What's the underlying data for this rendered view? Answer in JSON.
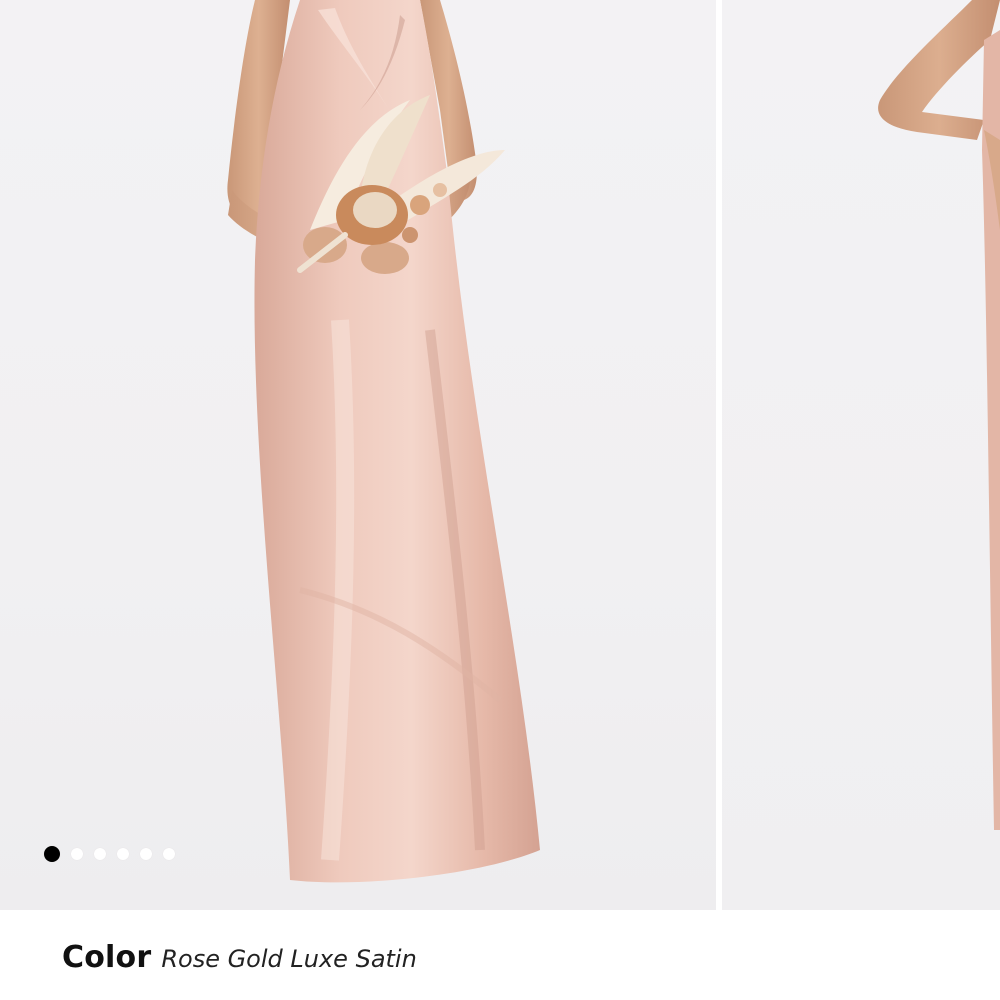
{
  "product": {
    "color_label": "Color",
    "color_value": "Rose Gold Luxe Satin",
    "dress_color": "#e8bfb1"
  },
  "gallery": {
    "slide_count": 6,
    "active_index": 0,
    "dots": [
      {
        "state": "active"
      },
      {
        "state": "inactive"
      },
      {
        "state": "inactive"
      },
      {
        "state": "inactive"
      },
      {
        "state": "inactive"
      },
      {
        "state": "inactive"
      }
    ]
  }
}
